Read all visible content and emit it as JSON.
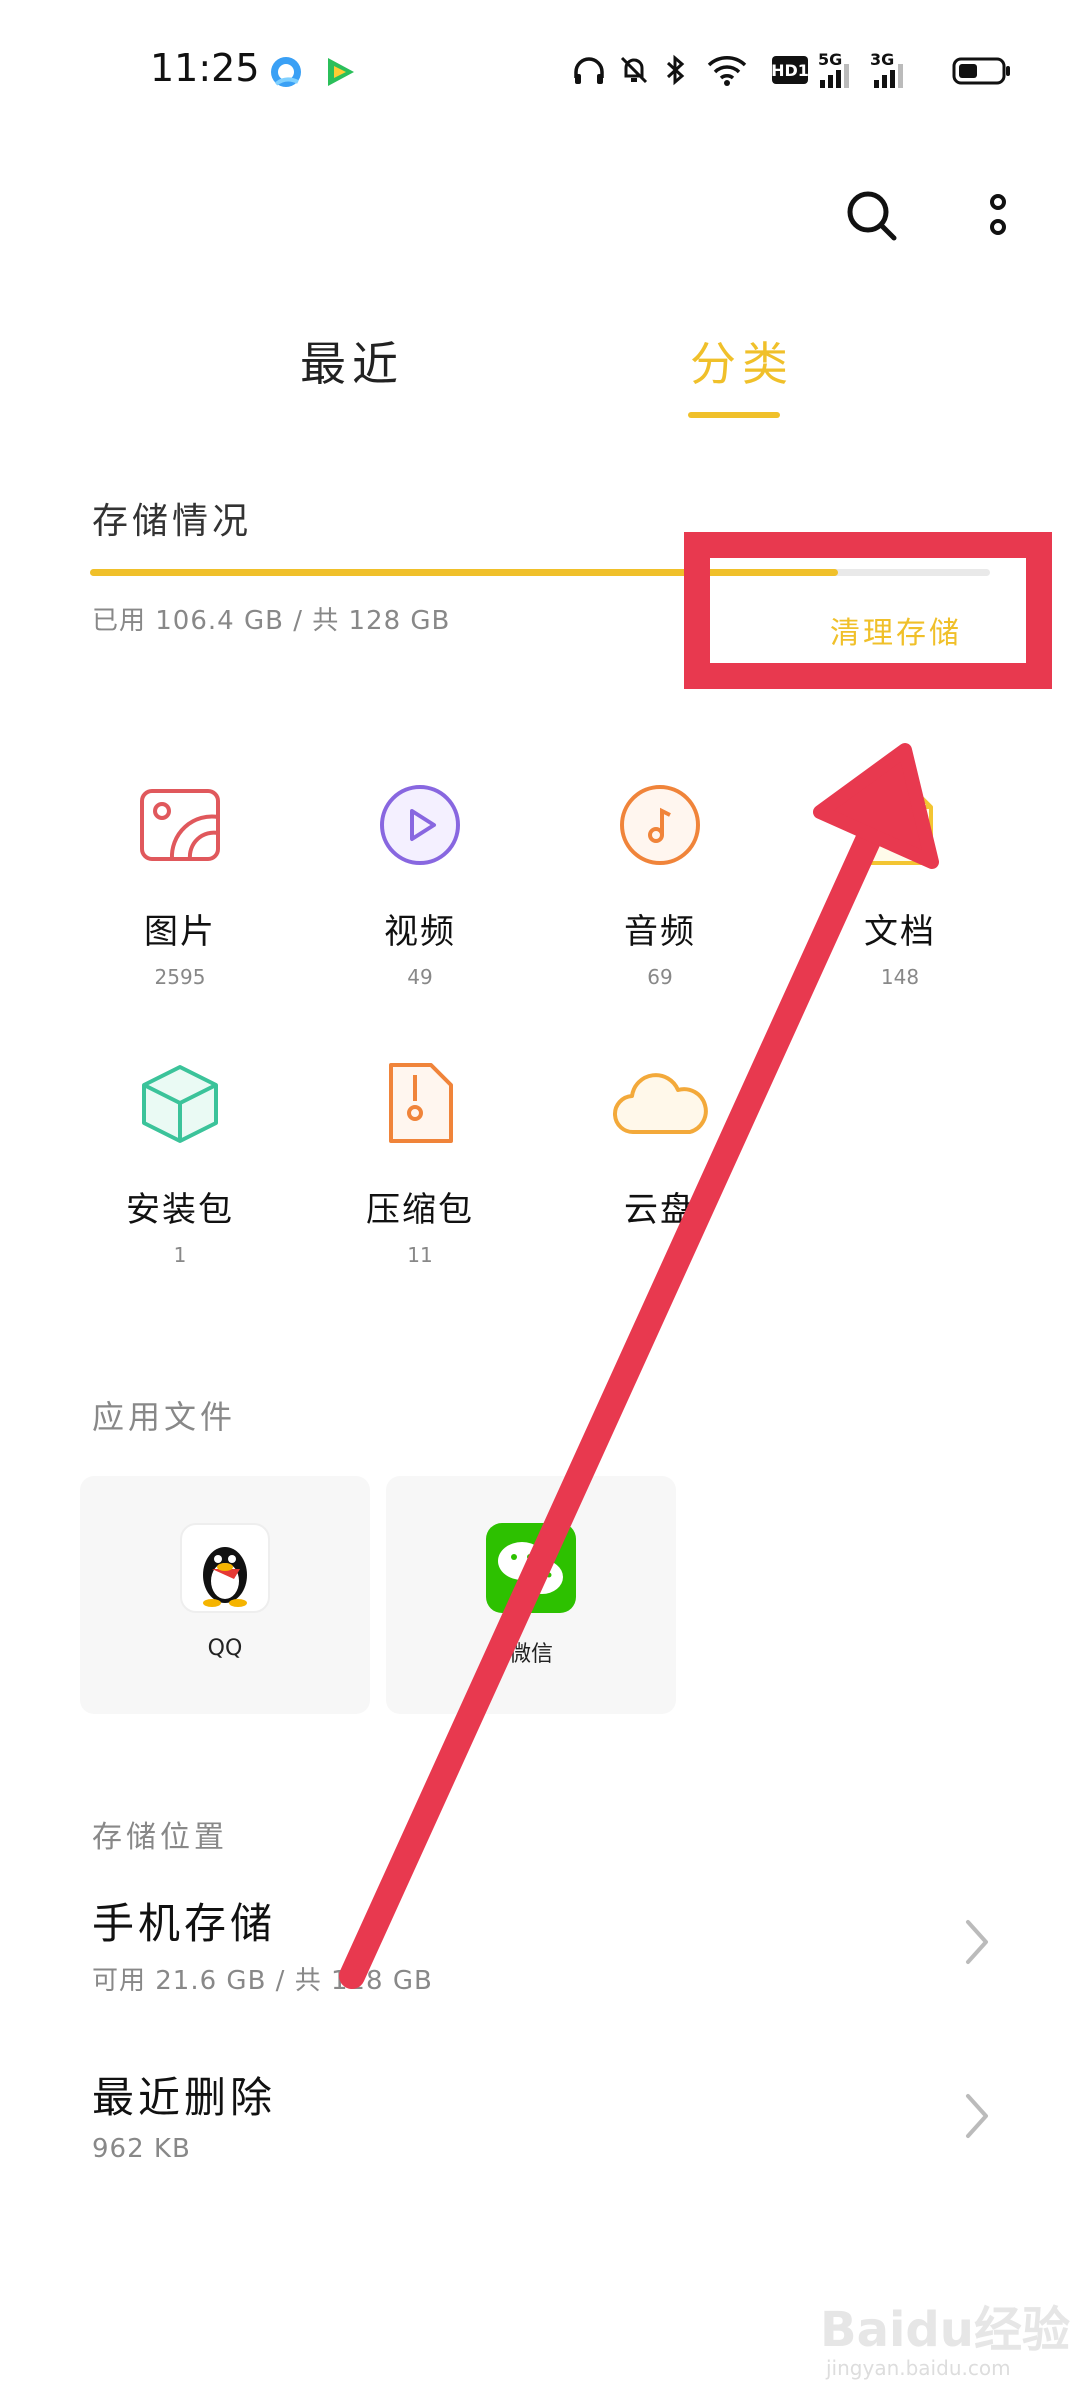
{
  "status_bar": {
    "time": "11:25",
    "hd_label": "HD1",
    "net1_label": "5G",
    "net2_label": "3G"
  },
  "toolbar": {
    "search_icon": "search-icon",
    "more_icon": "more-vertical-icon"
  },
  "tabs": [
    {
      "label": "最近",
      "active": false
    },
    {
      "label": "分类",
      "active": true
    }
  ],
  "storage": {
    "title": "存储情况",
    "used_text": "已用 106.4 GB / 共 128 GB",
    "used_fraction": 0.831,
    "clean_label": "清理存储"
  },
  "categories": [
    {
      "label": "图片",
      "count": "2595",
      "icon": "image-icon"
    },
    {
      "label": "视频",
      "count": "49",
      "icon": "video-icon"
    },
    {
      "label": "音频",
      "count": "69",
      "icon": "audio-icon"
    },
    {
      "label": "文档",
      "count": "148",
      "icon": "document-icon"
    },
    {
      "label": "安装包",
      "count": "1",
      "icon": "package-icon"
    },
    {
      "label": "压缩包",
      "count": "11",
      "icon": "archive-icon"
    },
    {
      "label": "云盘",
      "count": "",
      "icon": "cloud-icon"
    }
  ],
  "app_files": {
    "title": "应用文件",
    "apps": [
      {
        "name": "QQ",
        "icon": "qq-icon"
      },
      {
        "name": "微信",
        "icon": "wechat-icon"
      }
    ]
  },
  "storage_location": {
    "title": "存储位置",
    "items": [
      {
        "name": "手机存储",
        "sub": "可用 21.6 GB / 共 128 GB"
      },
      {
        "name": "最近删除",
        "sub": "962 KB"
      }
    ]
  },
  "watermark": {
    "brand": "Baidu经验",
    "url": "jingyan.baidu.com"
  },
  "colors": {
    "accent": "#f0c02a",
    "annotation": "#e8394f"
  }
}
